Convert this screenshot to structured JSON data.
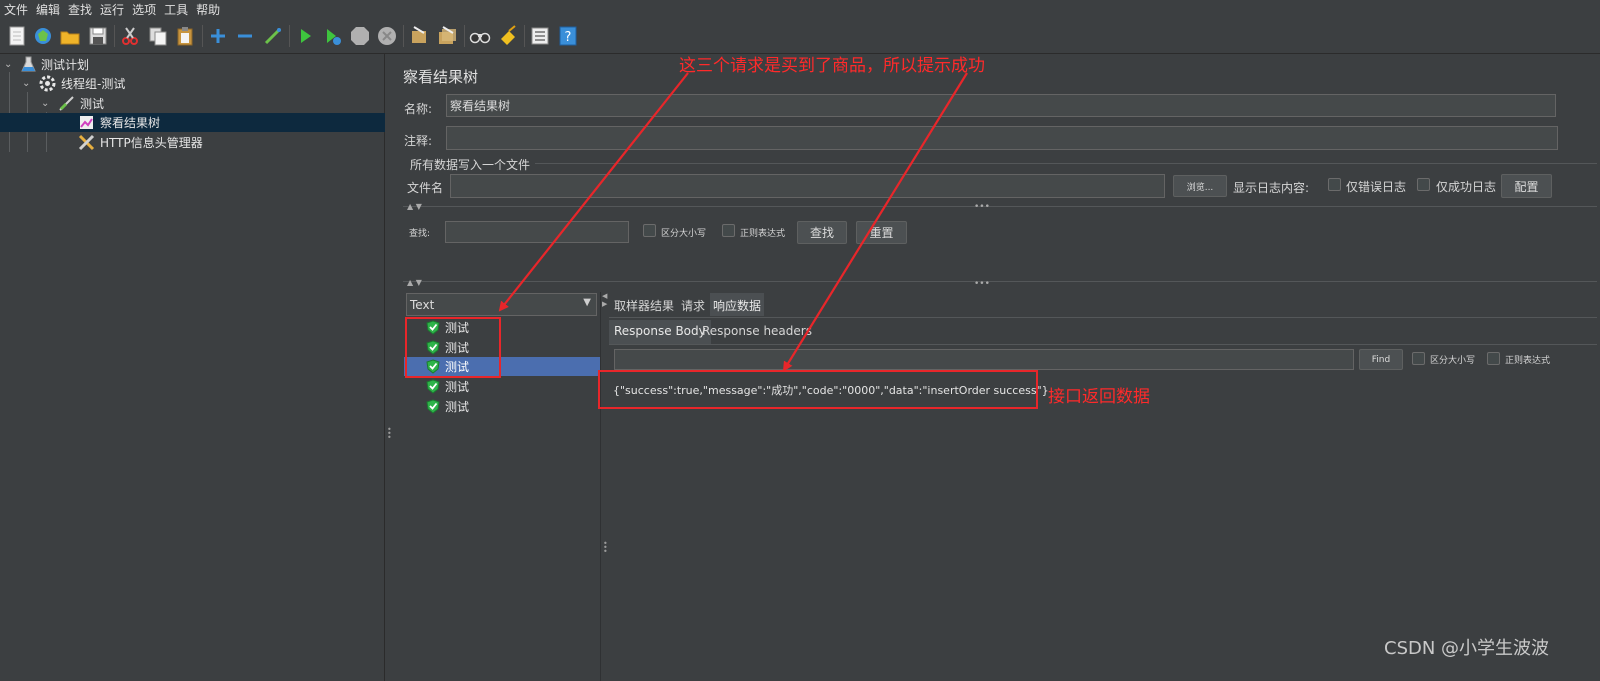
{
  "menubar": {
    "items": [
      "文件",
      "编辑",
      "查找",
      "运行",
      "选项",
      "工具",
      "帮助"
    ]
  },
  "toolbar": {
    "icons": [
      "new-icon",
      "templates-icon",
      "open-icon",
      "save-icon",
      "cut-icon",
      "copy-icon",
      "paste-icon",
      "expand-icon",
      "collapse-icon",
      "toggle-icon",
      "start-icon",
      "start-no-pause-icon",
      "stop-icon",
      "shutdown-icon",
      "clear-icon",
      "clear-all-icon",
      "search-icon",
      "reset-search-icon",
      "function-helper-icon",
      "help-icon"
    ]
  },
  "tree": {
    "items": [
      {
        "label": "测试计划",
        "icon": "test-plan-icon"
      },
      {
        "label": "线程组-测试",
        "icon": "thread-group-icon"
      },
      {
        "label": "测试",
        "icon": "http-sampler-icon"
      },
      {
        "label": "察看结果树",
        "icon": "result-tree-icon"
      },
      {
        "label": "HTTP信息头管理器",
        "icon": "header-manager-icon"
      }
    ]
  },
  "panel": {
    "title": "察看结果树",
    "name_label": "名称:",
    "name_value": "察看结果树",
    "comment_label": "注释:",
    "comment_value": "",
    "file_section_label": "所有数据写入一个文件",
    "filename_label": "文件名",
    "filename_value": "",
    "browse_label": "浏览...",
    "log_label": "显示日志内容:",
    "errors_only_label": "仅错误日志",
    "success_only_label": "仅成功日志",
    "configure_label": "配置"
  },
  "search": {
    "label": "查找:",
    "value": "",
    "case_label": "区分大小写",
    "regex_label": "正则表达式",
    "find_label": "查找",
    "reset_label": "重置"
  },
  "results": {
    "renderer": "Text",
    "items": [
      {
        "label": "测试",
        "status": "success"
      },
      {
        "label": "测试",
        "status": "success"
      },
      {
        "label": "测试",
        "status": "success"
      },
      {
        "label": "测试",
        "status": "success"
      },
      {
        "label": "测试",
        "status": "success"
      }
    ],
    "selected_index": 2
  },
  "detail": {
    "tabs": [
      "取样器结果",
      "请求",
      "响应数据"
    ],
    "active_tab": 2,
    "subtabs": [
      "Response Body",
      "Response headers"
    ],
    "active_subtab": 0,
    "search_value": "",
    "find_label": "Find",
    "case_label": "区分大小写",
    "regex_label": "正则表达式",
    "response_body": "{\"success\":true,\"message\":\"成功\",\"code\":\"0000\",\"data\":\"insertOrder success\"}"
  },
  "annotations": {
    "top_note": "这三个请求是买到了商品，所以提示成功",
    "side_note": "接口返回数据",
    "color": "#ff2a2a"
  },
  "watermark": "CSDN @小学生波波",
  "colors": {
    "background": "#3c3f41",
    "selection": "#4b6eaf",
    "tree_selection": "#0d293e",
    "success_shield": "#2fb34a"
  }
}
